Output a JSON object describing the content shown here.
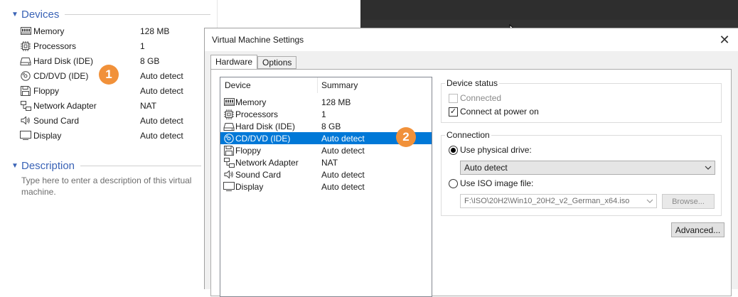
{
  "left_panel": {
    "devices_header": "Devices",
    "devices": [
      {
        "icon": "memory-icon",
        "name": "Memory",
        "value": "128 MB"
      },
      {
        "icon": "processor-icon",
        "name": "Processors",
        "value": "1"
      },
      {
        "icon": "hard-disk-icon",
        "name": "Hard Disk (IDE)",
        "value": "8 GB"
      },
      {
        "icon": "cd-dvd-icon",
        "name": "CD/DVD (IDE)",
        "value": "Auto detect"
      },
      {
        "icon": "floppy-icon",
        "name": "Floppy",
        "value": "Auto detect"
      },
      {
        "icon": "network-adapter-icon",
        "name": "Network Adapter",
        "value": "NAT"
      },
      {
        "icon": "sound-card-icon",
        "name": "Sound Card",
        "value": "Auto detect"
      },
      {
        "icon": "display-icon",
        "name": "Display",
        "value": "Auto detect"
      }
    ],
    "description_header": "Description",
    "description_placeholder": "Type here to enter a description of this virtual machine."
  },
  "badges": {
    "one": "1",
    "two": "2"
  },
  "colors": {
    "accent": "#3a63b6",
    "badge": "#f1913a",
    "selection": "#0078d7"
  },
  "dialog": {
    "title": "Virtual Machine Settings",
    "close_glyph": "✕",
    "tabs": [
      {
        "label": "Hardware",
        "active": true
      },
      {
        "label": "Options",
        "active": false
      }
    ],
    "list_headers": {
      "device": "Device",
      "summary": "Summary"
    },
    "devices": [
      {
        "icon": "memory-icon",
        "name": "Memory",
        "summary": "128 MB"
      },
      {
        "icon": "processor-icon",
        "name": "Processors",
        "summary": "1"
      },
      {
        "icon": "hard-disk-icon",
        "name": "Hard Disk (IDE)",
        "summary": "8 GB"
      },
      {
        "icon": "cd-dvd-icon",
        "name": "CD/DVD (IDE)",
        "summary": "Auto detect",
        "selected": true
      },
      {
        "icon": "floppy-icon",
        "name": "Floppy",
        "summary": "Auto detect"
      },
      {
        "icon": "network-adapter-icon",
        "name": "Network Adapter",
        "summary": "NAT"
      },
      {
        "icon": "sound-card-icon",
        "name": "Sound Card",
        "summary": "Auto detect"
      },
      {
        "icon": "display-icon",
        "name": "Display",
        "summary": "Auto detect"
      }
    ],
    "device_status": {
      "legend": "Device status",
      "connected_label": "Connected",
      "connected_checked": false,
      "connected_enabled": false,
      "power_on_label": "Connect at power on",
      "power_on_checked": true
    },
    "connection": {
      "legend": "Connection",
      "physical_label": "Use physical drive:",
      "physical_selected": true,
      "physical_value": "Auto detect",
      "iso_label": "Use ISO image file:",
      "iso_selected": false,
      "iso_value": "F:\\ISO\\20H2\\Win10_20H2_v2_German_x64.iso",
      "browse_label": "Browse..."
    },
    "advanced_label": "Advanced..."
  }
}
